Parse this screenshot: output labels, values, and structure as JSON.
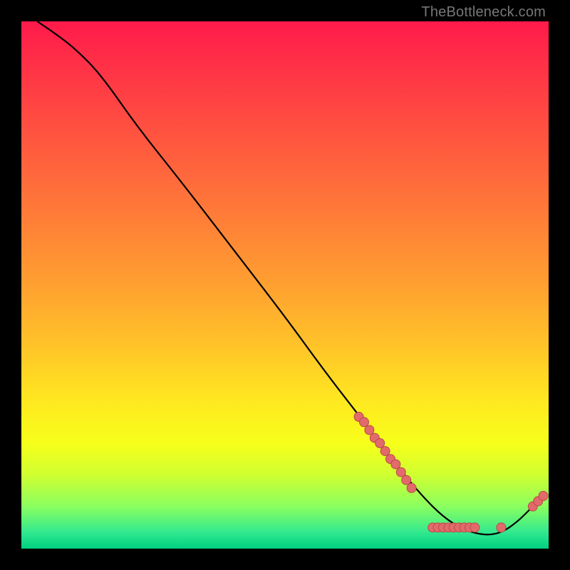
{
  "watermark": "TheBottleneck.com",
  "chart_data": {
    "type": "line",
    "title": "",
    "xlabel": "",
    "ylabel": "",
    "xlim": [
      0,
      100
    ],
    "ylim": [
      0,
      100
    ],
    "curve": [
      {
        "x": 3,
        "y": 100
      },
      {
        "x": 6,
        "y": 98
      },
      {
        "x": 10,
        "y": 95
      },
      {
        "x": 15,
        "y": 90
      },
      {
        "x": 22,
        "y": 80
      },
      {
        "x": 30,
        "y": 70
      },
      {
        "x": 40,
        "y": 57
      },
      {
        "x": 50,
        "y": 44
      },
      {
        "x": 58,
        "y": 33
      },
      {
        "x": 65,
        "y": 24
      },
      {
        "x": 71,
        "y": 16
      },
      {
        "x": 76,
        "y": 10
      },
      {
        "x": 80,
        "y": 6
      },
      {
        "x": 84,
        "y": 3.5
      },
      {
        "x": 88,
        "y": 2.5
      },
      {
        "x": 91,
        "y": 3
      },
      {
        "x": 94,
        "y": 5
      },
      {
        "x": 97,
        "y": 8
      },
      {
        "x": 99,
        "y": 10
      }
    ],
    "points": [
      {
        "x": 64,
        "y": 25
      },
      {
        "x": 65,
        "y": 24
      },
      {
        "x": 66,
        "y": 22.5
      },
      {
        "x": 67,
        "y": 21
      },
      {
        "x": 68,
        "y": 20
      },
      {
        "x": 69,
        "y": 18.5
      },
      {
        "x": 70,
        "y": 17
      },
      {
        "x": 71,
        "y": 16
      },
      {
        "x": 72,
        "y": 14.5
      },
      {
        "x": 73,
        "y": 13
      },
      {
        "x": 74,
        "y": 11.5
      },
      {
        "x": 78,
        "y": 4
      },
      {
        "x": 79,
        "y": 4
      },
      {
        "x": 80,
        "y": 4
      },
      {
        "x": 81,
        "y": 4
      },
      {
        "x": 82,
        "y": 4
      },
      {
        "x": 83,
        "y": 4
      },
      {
        "x": 84,
        "y": 4
      },
      {
        "x": 85,
        "y": 4
      },
      {
        "x": 86,
        "y": 4
      },
      {
        "x": 91,
        "y": 4
      },
      {
        "x": 97,
        "y": 8
      },
      {
        "x": 98,
        "y": 9
      },
      {
        "x": 99,
        "y": 10
      }
    ],
    "colors": {
      "curve": "#000000",
      "points_fill": "#e26a6a",
      "points_stroke": "#b84a4a"
    }
  }
}
